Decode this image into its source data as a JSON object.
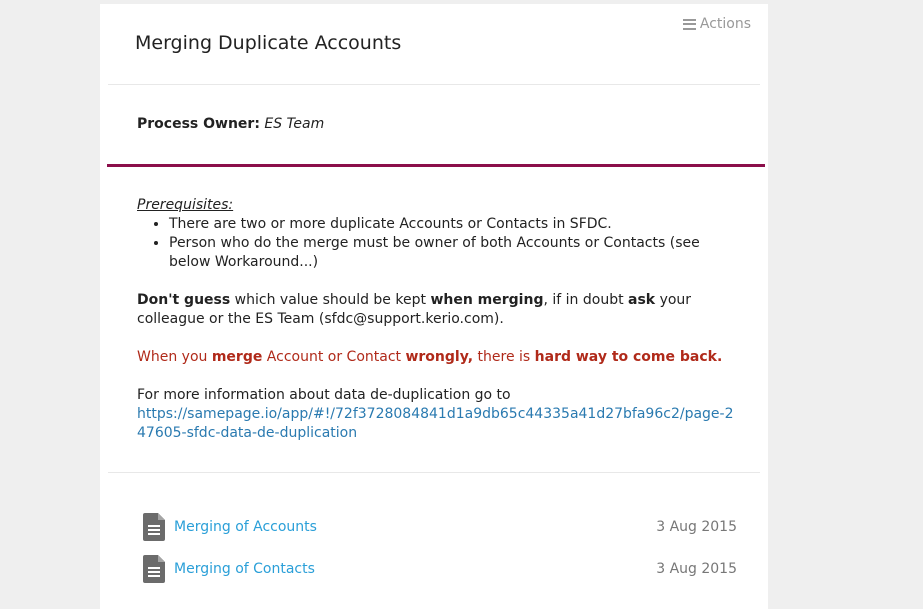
{
  "header": {
    "actions_label": "Actions",
    "title": "Merging Duplicate Accounts"
  },
  "owner": {
    "label": "Process Owner:",
    "value": "ES Team"
  },
  "body": {
    "prereq_heading": "Prerequisites:",
    "prereq_items": [
      "There are two or more duplicate Accounts or Contacts in SFDC.",
      "Person who do the merge must be owner of both Accounts or Contacts (see below Workaround...)"
    ],
    "advice": {
      "b1": "Don't guess",
      "t1": " which value should be kept ",
      "b2": "when merging",
      "t2": ", if in doubt ",
      "b3": "ask",
      "t3": " your colleague or the ES Team (sfdc@support.kerio.com)."
    },
    "warning": {
      "t1": "When you ",
      "b1": "merge",
      "t2": " Account or Contact ",
      "b2": "wrongly,",
      "t3": " there is ",
      "b3": "hard way to come back."
    },
    "more_info_text": "For more information about data de-duplication go to",
    "more_info_link": "https://samepage.io/app/#!/72f3728084841d1a9db65c44335a41d27bfa96c2/page-247605-sfdc-data-de-duplication"
  },
  "documents": [
    {
      "name": "Merging of Accounts",
      "date": "3 Aug 2015",
      "icon": "document-icon"
    },
    {
      "name": "Merging of Contacts",
      "date": "3 Aug 2015",
      "icon": "document-icon"
    }
  ],
  "colors": {
    "accent_divider": "#8b0e4a",
    "warning_text": "#b02a1a",
    "link": "#2a7ab0",
    "doc_link": "#2a9fd8"
  }
}
